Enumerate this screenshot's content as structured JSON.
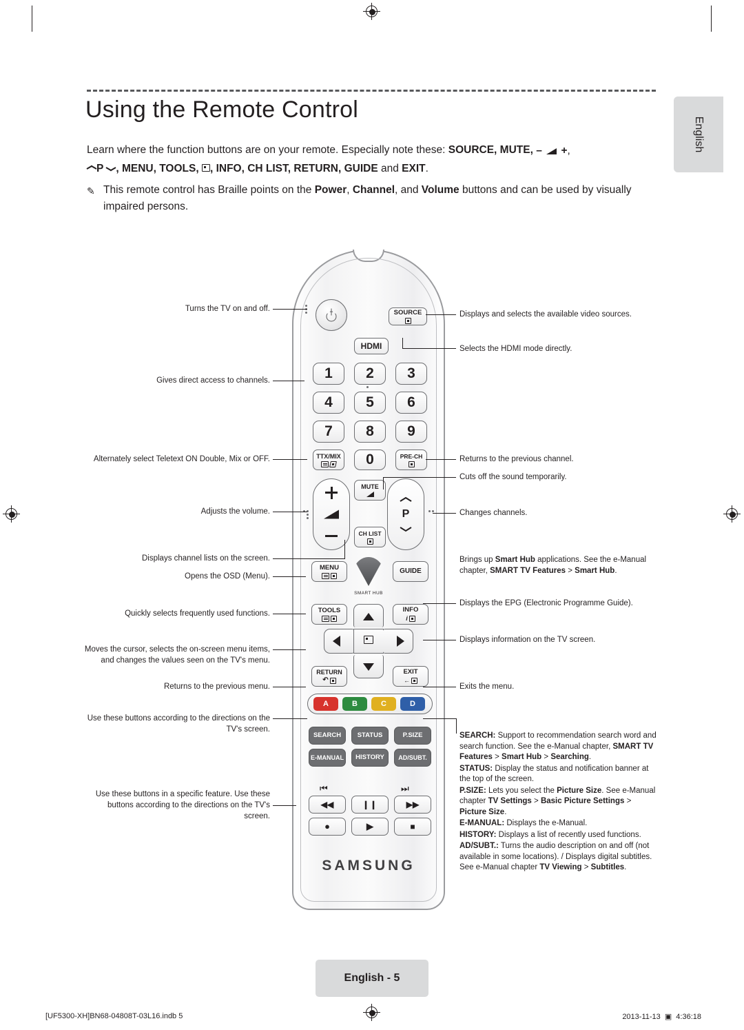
{
  "page": {
    "title": "Using the Remote Control",
    "intro_line1_a": "Learn where the function buttons are on your remote. Especially note these: ",
    "intro_bold1": "SOURCE, MUTE,",
    "intro_line2_bold": "P ",
    "intro_line2_bold_b": ", MENU, TOOLS, ",
    "intro_line2_bold_c": ", INFO, CH LIST, RETURN, GUIDE",
    "intro_line2_and": " and ",
    "intro_line2_exit": "EXIT",
    "intro_line2_period": ".",
    "note_a": "This remote control has Braille points on the ",
    "note_power": "Power",
    "note_b": ", ",
    "note_channel": "Channel",
    "note_c": ", and ",
    "note_volume": "Volume",
    "note_d": " buttons and can be used by visually impaired persons.",
    "side_tab": "English",
    "page_badge": "English - 5",
    "print_left": "[UF5300-XH]BN68-04808T-03L16.indb   5",
    "print_right_date": "2013-11-13",
    "print_right_time": "4:36:18"
  },
  "remote": {
    "brand": "SAMSUNG",
    "keys": {
      "source": "SOURCE",
      "hdmi": "HDMI",
      "n1": "1",
      "n2": "2",
      "n3": "3",
      "n4": "4",
      "n5": "5",
      "n6": "6",
      "n7": "7",
      "n8": "8",
      "n9": "9",
      "n0": "0",
      "ttxmix": "TTX/MIX",
      "prech": "PRE-CH",
      "mute": "MUTE",
      "chlist": "CH LIST",
      "p": "P",
      "menu": "MENU",
      "guide": "GUIDE",
      "smarthub": "SMART HUB",
      "tools": "TOOLS",
      "info": "INFO",
      "return": "RETURN",
      "exit": "EXIT",
      "color_a": "A",
      "color_b": "B",
      "color_c": "C",
      "color_d": "D",
      "search": "SEARCH",
      "status": "STATUS",
      "psize": "P.SIZE",
      "emanual": "E-MANUAL",
      "history": "HISTORY",
      "adsubt": "AD/SUBT."
    },
    "colors": {
      "a": "#d7332d",
      "b": "#2d8b3f",
      "c": "#e0b020",
      "d": "#2f5fa8",
      "dark_key": "#6d6e71"
    }
  },
  "callouts": {
    "left": [
      {
        "id": "power",
        "text": "Turns the TV on and off."
      },
      {
        "id": "numbers",
        "text": "Gives direct access to channels."
      },
      {
        "id": "ttxmix",
        "text": "Alternately select Teletext ON Double, Mix or OFF."
      },
      {
        "id": "volume",
        "text": "Adjusts the volume."
      },
      {
        "id": "chlist",
        "text": "Displays channel lists on the screen."
      },
      {
        "id": "menu",
        "text": "Opens the OSD (Menu)."
      },
      {
        "id": "tools",
        "text": "Quickly selects frequently used functions."
      },
      {
        "id": "dpad",
        "text": "Moves the cursor, selects the on-screen menu items, and changes the values seen on the TV's menu."
      },
      {
        "id": "return",
        "text": "Returns to the previous menu."
      },
      {
        "id": "colors",
        "text": "Use these buttons according to the directions on the TV's screen."
      },
      {
        "id": "media",
        "text": "Use these buttons in a specific feature. Use these buttons according to the directions on the TV's screen."
      }
    ],
    "right": [
      {
        "id": "source",
        "text": "Displays and selects the available video sources."
      },
      {
        "id": "hdmi",
        "text": "Selects the HDMI mode directly."
      },
      {
        "id": "prech",
        "text": "Returns to the previous channel."
      },
      {
        "id": "mute",
        "text": "Cuts off the sound temporarily."
      },
      {
        "id": "channel",
        "text": "Changes channels."
      },
      {
        "id": "guide",
        "text": "Displays the EPG (Electronic Programme Guide)."
      },
      {
        "id": "info",
        "text": "Displays information on the TV screen."
      },
      {
        "id": "exit",
        "text": "Exits the menu."
      }
    ],
    "smarthub": {
      "a": "Brings up ",
      "smart_hub": "Smart Hub",
      "b": " applications. See the e-Manual chapter, ",
      "chapter": "SMART TV Features",
      "gt1": " > ",
      "hub": "Smart Hub",
      "end": "."
    }
  },
  "legend": [
    {
      "label": "SEARCH:",
      "parts": [
        {
          "t": " Support to recommendation search word and search function. See the e-Manual chapter, ",
          "b": false
        },
        {
          "t": "SMART TV Features",
          "b": true
        },
        {
          "t": " > ",
          "b": false
        },
        {
          "t": "Smart Hub",
          "b": true
        },
        {
          "t": " > ",
          "b": false
        },
        {
          "t": "Searching",
          "b": true
        },
        {
          "t": ".",
          "b": false
        }
      ]
    },
    {
      "label": "STATUS:",
      "parts": [
        {
          "t": " Display the status and notification banner at the top of the screen.",
          "b": false
        }
      ]
    },
    {
      "label": "P.SIZE:",
      "parts": [
        {
          "t": " Lets you select the ",
          "b": false
        },
        {
          "t": "Picture Size",
          "b": true
        },
        {
          "t": ". See e-Manual chapter ",
          "b": false
        },
        {
          "t": "TV Settings",
          "b": true
        },
        {
          "t": " > ",
          "b": false
        },
        {
          "t": "Basic Picture Settings",
          "b": true
        },
        {
          "t": " > ",
          "b": false
        },
        {
          "t": "Picture Size",
          "b": true
        },
        {
          "t": ".",
          "b": false
        }
      ]
    },
    {
      "label": "E-MANUAL:",
      "parts": [
        {
          "t": " Displays the e-Manual.",
          "b": false
        }
      ]
    },
    {
      "label": "HISTORY:",
      "parts": [
        {
          "t": " Displays a list of recently used functions.",
          "b": false
        }
      ]
    },
    {
      "label": "AD/SUBT.:",
      "parts": [
        {
          "t": " Turns the audio description on and off (not available in some locations). / Displays digital subtitles. See e-Manual chapter ",
          "b": false
        },
        {
          "t": "TV Viewing",
          "b": true
        },
        {
          "t": " > ",
          "b": false
        },
        {
          "t": "Subtitles",
          "b": true
        },
        {
          "t": ".",
          "b": false
        }
      ]
    }
  ]
}
